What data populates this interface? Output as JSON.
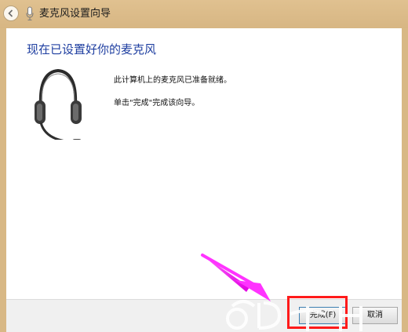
{
  "window": {
    "title": "麦克风设置向导"
  },
  "titlebar": {
    "back_icon": "back-arrow-icon",
    "app_icon": "microphone-icon"
  },
  "main": {
    "heading": "现在已设置好你的麦克风",
    "illustration_icon": "headset-icon",
    "line1": "此计算机上的麦克风已准备就绪。",
    "line2": "单击\"完成\"完成该向导。"
  },
  "footer": {
    "finish_label": "完成(F)",
    "cancel_label": "取消"
  },
  "annotations": {
    "arrow_color": "#ff33ff",
    "highlight_color": "#ff1a1a"
  },
  "colors": {
    "titlebar": "#d8b885",
    "heading": "#1e3ea0"
  }
}
